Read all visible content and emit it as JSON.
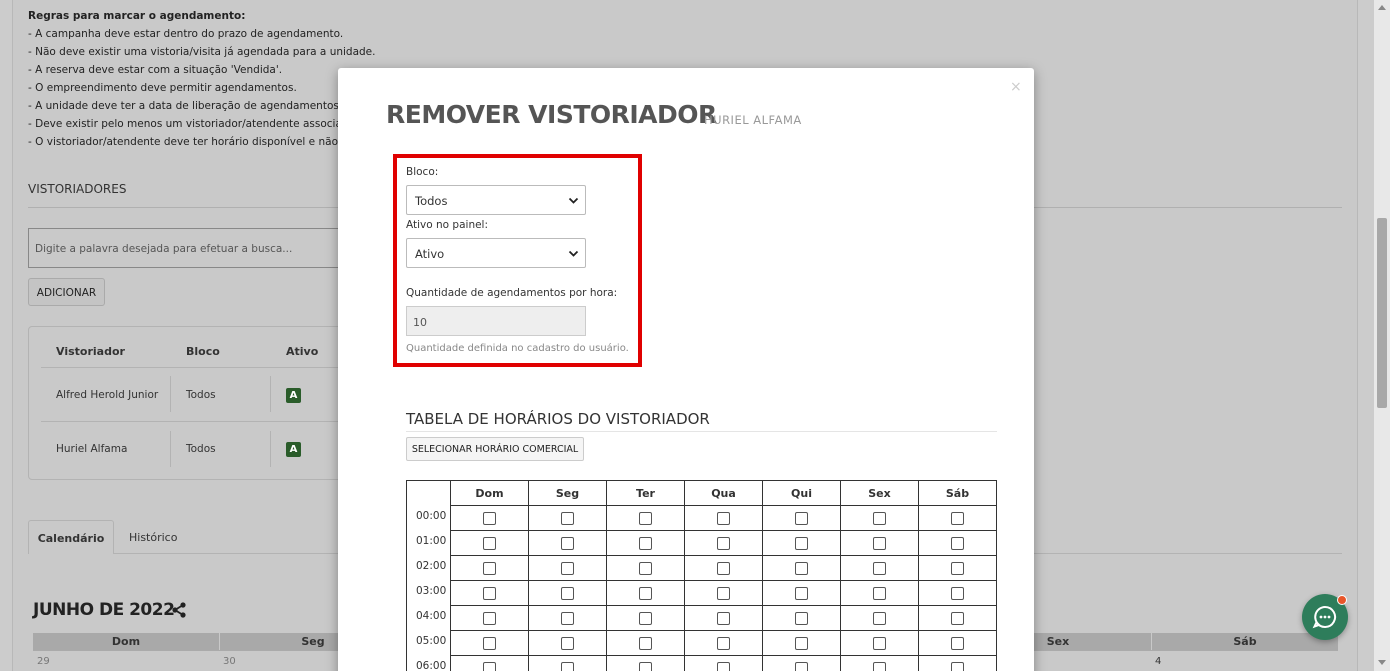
{
  "rules": {
    "title": "Regras para marcar o agendamento:",
    "items": [
      "- A campanha deve estar dentro do prazo de agendamento.",
      "- Não deve existir uma vistoria/visita já agendada para a unidade.",
      "- A reserva deve estar com a situação 'Vendida'.",
      "- O empreendimento deve permitir agendamentos.",
      "- A unidade deve ter a data de liberação de agendamentos mer",
      "- Deve existir pelo menos um vistoriador/atendente associado ",
      "- O vistoriador/atendente deve ter horário disponível e não poc"
    ]
  },
  "vistoriadores": {
    "section_title": "VISTORIADORES",
    "search_placeholder": "Digite a palavra desejada para efetuar a busca...",
    "add_label": "ADICIONAR",
    "columns": [
      "Vistoriador",
      "Bloco",
      "Ativo"
    ],
    "rows": [
      {
        "name": "Alfred Herold Junior",
        "bloco": "Todos",
        "ativo": "A"
      },
      {
        "name": "Huriel Alfama",
        "bloco": "Todos",
        "ativo": "A"
      }
    ]
  },
  "tabs": [
    "Calendário",
    "Histórico"
  ],
  "calendar": {
    "title": "JUNHO DE 2022",
    "days": [
      "Dom",
      "Seg",
      "Sex",
      "Sáb"
    ],
    "visible_numbers": [
      "29",
      "30",
      "4"
    ]
  },
  "modal": {
    "close": "×",
    "title": "REMOVER VISTORIADOR",
    "subtitle": "HURIEL ALFAMA",
    "bloco_label": "Bloco:",
    "bloco_value": "Todos",
    "ativo_label": "Ativo no painel:",
    "ativo_value": "Ativo",
    "qty_label": "Quantidade de agendamentos por hora:",
    "qty_value": "10",
    "qty_hint": "Quantidade definida no cadastro do usuário.",
    "schedule_title": "TABELA DE HORÁRIOS DO VISTORIADOR",
    "commercial_button": "SELECIONAR HORÁRIO COMERCIAL",
    "schedule_days": [
      "Dom",
      "Seg",
      "Ter",
      "Qua",
      "Qui",
      "Sex",
      "Sáb"
    ],
    "schedule_hours": [
      "00:00",
      "01:00",
      "02:00",
      "03:00",
      "04:00",
      "05:00",
      "06:00"
    ]
  },
  "colors": {
    "highlight": "#e00000",
    "active_badge": "#2a5c2a",
    "chat_button": "#2e7d5b"
  },
  "icons": [
    "share-icon",
    "chevron-down-icon",
    "chat-icon",
    "close-icon"
  ]
}
